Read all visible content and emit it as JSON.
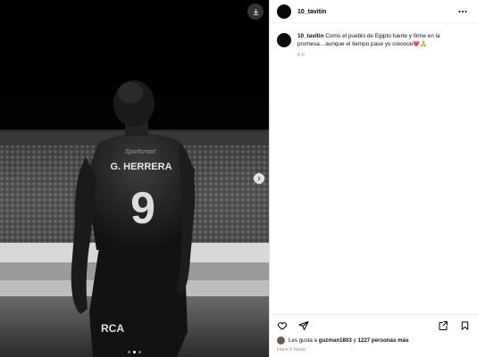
{
  "post": {
    "username": "10_tavitin",
    "caption": {
      "username": "10_tavitin",
      "text": "Como el pueblo de Egipto fuerte y firme en la promesa…aunque el tiempo pase yo creoooo",
      "emoji": "💗🙏",
      "time": "8 h"
    },
    "likes": {
      "prefix": "Les gusta a",
      "user": "guzman1803",
      "connector": "y",
      "others": "1227 personas más"
    },
    "posted_ago": "Hace 8 horas"
  },
  "media": {
    "jersey_name": "G. HERRERA",
    "jersey_number": "9",
    "sponsor_top": "Sportsmart",
    "sponsor_bottom": "RCA",
    "carousel_index": 2,
    "carousel_count": 3
  },
  "icons": {
    "download": "download-icon",
    "next": "chevron-right-icon",
    "more": "more-horizontal-icon",
    "like": "heart-icon",
    "share": "share-icon",
    "repost": "repost-icon",
    "save": "bookmark-icon"
  }
}
